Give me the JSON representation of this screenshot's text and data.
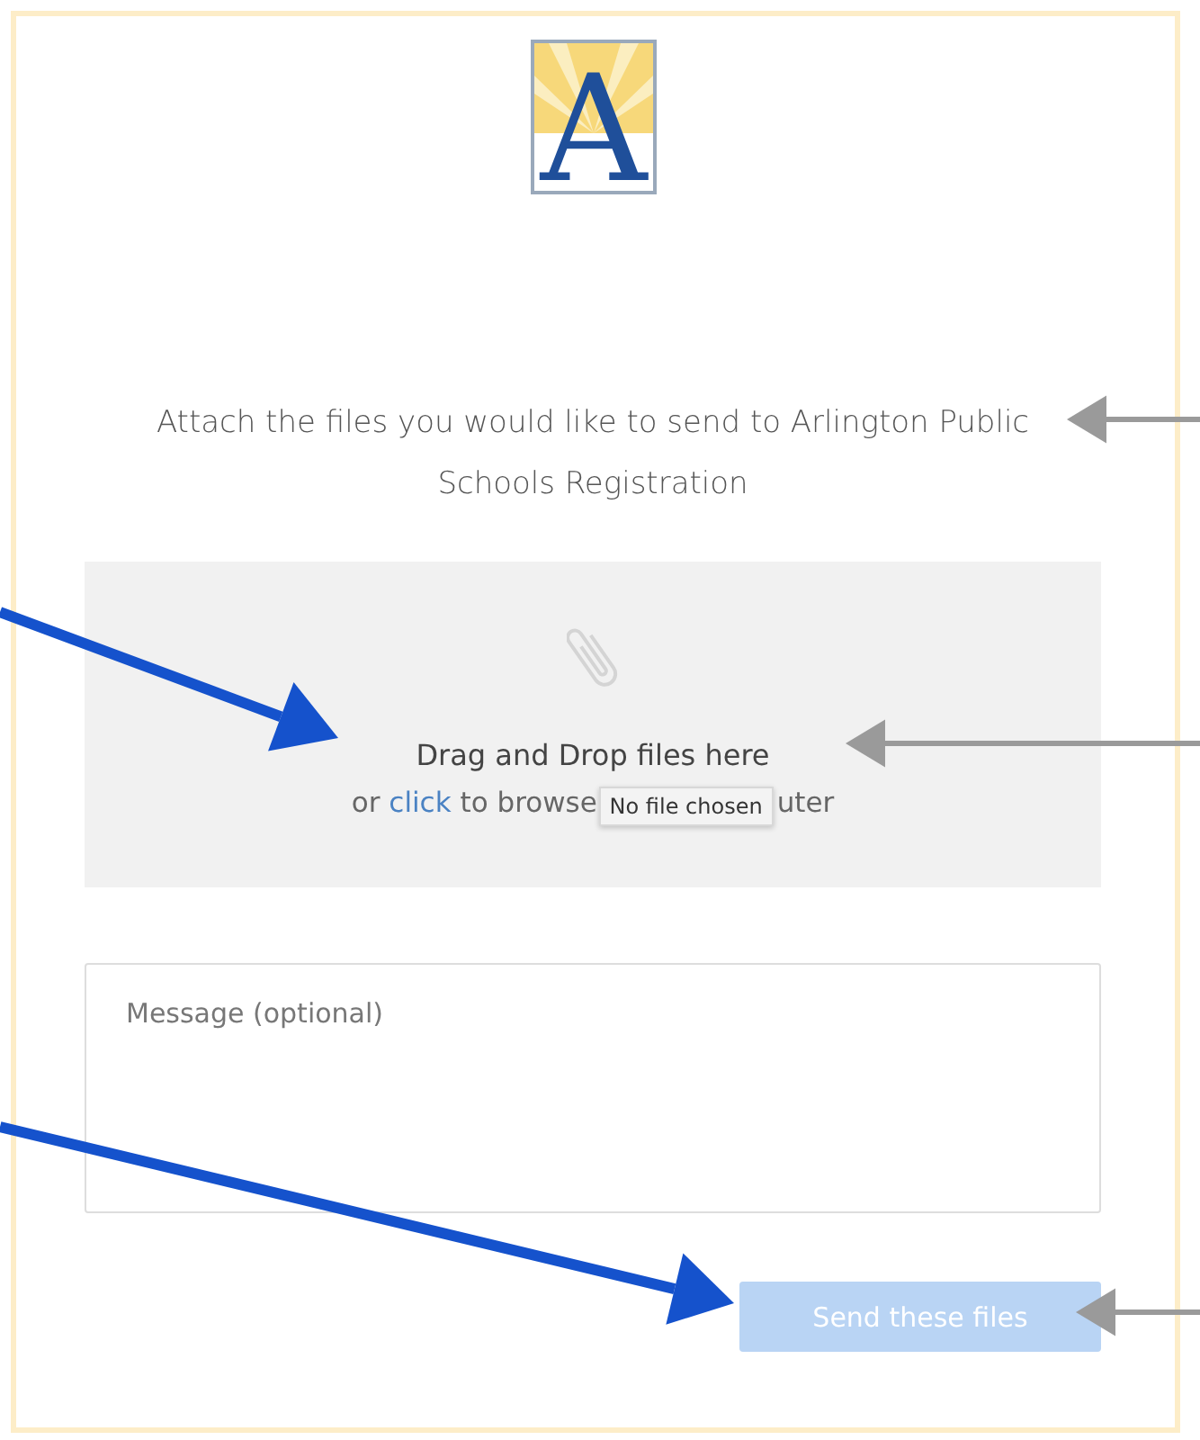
{
  "logo": {
    "letter": "A"
  },
  "intro": "Attach the files you would like to send to Arlington Public Schools Registration",
  "dropzone": {
    "title": "Drag and Drop files here",
    "browse_prefix": "or ",
    "browse_link": "click",
    "browse_rest": " to browse ",
    "browse_tail": "uter",
    "tooltip": "No file chosen"
  },
  "message": {
    "placeholder": "Message (optional)"
  },
  "send_button": {
    "label": "Send these files",
    "disabled": true
  }
}
